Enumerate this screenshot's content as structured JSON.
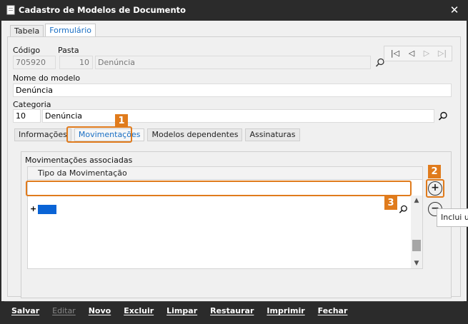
{
  "window": {
    "title": "Cadastro de Modelos de Documento",
    "close_glyph": "✕"
  },
  "top_tabs": [
    {
      "label": "Tabela",
      "active": false
    },
    {
      "label": "Formulário",
      "active": true
    }
  ],
  "fields": {
    "codigo_label": "Código",
    "codigo_value": "705920",
    "pasta_label": "Pasta",
    "pasta_number": "10",
    "pasta_name": "Denúncia",
    "nome_label": "Nome do modelo",
    "nome_value": "Denúncia",
    "categoria_label": "Categoria",
    "categoria_number": "10",
    "categoria_name": "Denúncia"
  },
  "record_nav": {
    "first": "|◁",
    "prev": "◁",
    "next": "▷",
    "last": "▷|"
  },
  "sub_tabs": [
    {
      "label": "Informações",
      "active": false
    },
    {
      "label": "Movimentações",
      "active": true
    },
    {
      "label": "Modelos dependentes",
      "active": false
    },
    {
      "label": "Assinaturas",
      "active": false
    }
  ],
  "movimentacoes": {
    "group_label": "Movimentações associadas",
    "column_header": "Tipo da Movimentação",
    "new_row_marker": "+",
    "add_glyph": "+",
    "remove_glyph": "−",
    "tooltip": "Inclui ur"
  },
  "callouts": {
    "one": "1",
    "two": "2",
    "three": "3"
  },
  "actions": [
    {
      "label": "Salvar",
      "enabled": true
    },
    {
      "label": "Editar",
      "enabled": false
    },
    {
      "label": "Novo",
      "enabled": true
    },
    {
      "label": "Excluir",
      "enabled": true
    },
    {
      "label": "Limpar",
      "enabled": true
    },
    {
      "label": "Restaurar",
      "enabled": true
    },
    {
      "label": "Imprimir",
      "enabled": true
    },
    {
      "label": "Fechar",
      "enabled": true
    }
  ],
  "colors": {
    "accent": "#e07b1c",
    "selection": "#0a64d6",
    "titlebar": "#2b2b2b",
    "tab_active_text": "#1a6fc4"
  },
  "icons": [
    "app-icon",
    "close-icon",
    "search-icon",
    "first-record-icon",
    "prev-record-icon",
    "next-record-icon",
    "last-record-icon",
    "filter-clear-icon",
    "add-circle-icon",
    "remove-circle-icon",
    "scroll-up-icon",
    "scroll-down-icon"
  ]
}
